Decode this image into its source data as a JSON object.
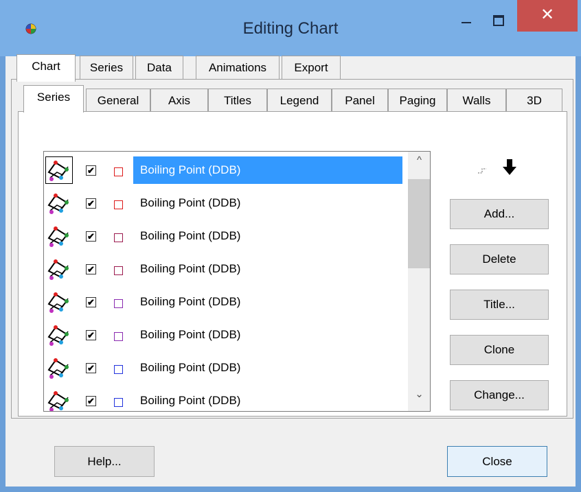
{
  "window": {
    "title": "Editing Chart",
    "close_glyph": "✕"
  },
  "tabs_top": [
    {
      "label": "Chart"
    },
    {
      "label": "Series"
    },
    {
      "label": "Data"
    },
    {
      "label": "Animations"
    },
    {
      "label": "Export"
    }
  ],
  "tabs_sub": [
    {
      "label": "Series"
    },
    {
      "label": "General"
    },
    {
      "label": "Axis"
    },
    {
      "label": "Titles"
    },
    {
      "label": "Legend"
    },
    {
      "label": "Panel"
    },
    {
      "label": "Paging"
    },
    {
      "label": "Walls"
    },
    {
      "label": "3D"
    }
  ],
  "series_list": [
    {
      "label": "Boiling Point (DDB)",
      "checked": true,
      "color": "#dd1a1a",
      "selected": true
    },
    {
      "label": "Boiling Point (DDB)",
      "checked": true,
      "color": "#dd1a1a",
      "selected": false
    },
    {
      "label": "Boiling Point (DDB)",
      "checked": true,
      "color": "#9b1a4e",
      "selected": false
    },
    {
      "label": "Boiling Point (DDB)",
      "checked": true,
      "color": "#9b1a4e",
      "selected": false
    },
    {
      "label": "Boiling Point (DDB)",
      "checked": true,
      "color": "#8a2ab0",
      "selected": false
    },
    {
      "label": "Boiling Point (DDB)",
      "checked": true,
      "color": "#8a2ab0",
      "selected": false
    },
    {
      "label": "Boiling Point (DDB)",
      "checked": true,
      "color": "#2233dd",
      "selected": false
    },
    {
      "label": "Boiling Point (DDB)",
      "checked": true,
      "color": "#2233dd",
      "selected": false
    }
  ],
  "side_buttons": {
    "add": "Add...",
    "delete": "Delete",
    "title": "Title...",
    "clone": "Clone",
    "change": "Change..."
  },
  "bottom_buttons": {
    "help": "Help...",
    "close": "Close"
  },
  "icons": {
    "app": "chart-app-icon",
    "series_type": "line-series-icon",
    "move_up": "move-up-icon",
    "move_down": "move-down-icon"
  },
  "colors": {
    "titlebar": "#7aafe6",
    "close_button": "#c7504e",
    "selection": "#3399ff"
  }
}
